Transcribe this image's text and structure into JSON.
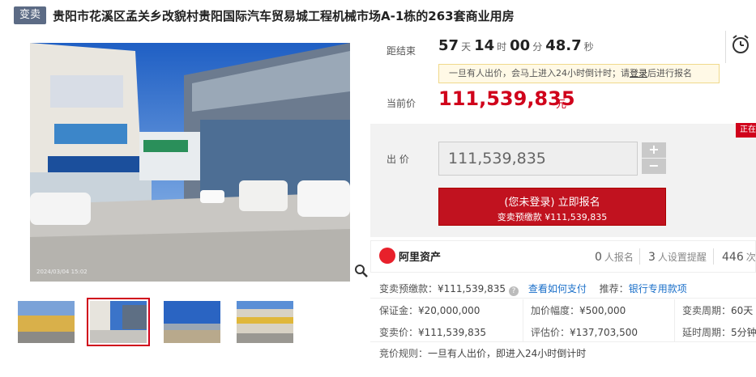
{
  "header": {
    "tag": "变卖",
    "title": "贵阳市花溪区孟关乡改貌村贵阳国际汽车贸易城工程机械市场A-1栋的263套商业用房"
  },
  "gallery": {
    "photo_timestamp": "2024/03/04 15:02",
    "thumbnails": [
      {
        "name": "thumbnail-1",
        "selected": false
      },
      {
        "name": "thumbnail-2",
        "selected": true
      },
      {
        "name": "thumbnail-3",
        "selected": false
      },
      {
        "name": "thumbnail-4",
        "selected": false
      }
    ]
  },
  "countdown": {
    "label": "距结束",
    "days": "57",
    "days_unit": "天",
    "hours": "14",
    "hours_unit": "时",
    "minutes": "00",
    "minutes_unit": "分",
    "seconds": "48.7",
    "seconds_unit": "秒"
  },
  "notice": {
    "before": "一旦有人出价，会马上进入24小时倒计时；请",
    "login": "登录",
    "after": "后进行报名"
  },
  "current_price": {
    "label": "当前价",
    "value": "111,539,835",
    "unit": "元"
  },
  "bid": {
    "label": "出 价",
    "value": "111,539,835",
    "plus": "+",
    "minus": "−",
    "ribbon": "正在进行",
    "button_line1": "(您未登录) 立即报名",
    "button_line2": "变卖预缴款 ¥111,539,835"
  },
  "platform": {
    "name": "阿里资产",
    "enrolled_count": "0",
    "enrolled_label": "人报名",
    "reminder_count": "3",
    "reminder_label": "人设置提醒",
    "views_count": "446",
    "views_label": "次"
  },
  "info": {
    "deposit_label": "变卖预缴款：",
    "deposit_value": "¥111,539,835",
    "pay_link": "查看如何支付",
    "recommend_label": "推荐：",
    "recommend_link": "银行专用款项",
    "rows": [
      {
        "k1": "保证金：",
        "v1": "¥20,000,000",
        "k2": "加价幅度：",
        "v2": "¥500,000",
        "k3": "变卖周期：",
        "v3": "60天"
      },
      {
        "k1": "变卖价：",
        "v1": "¥111,539,835",
        "k2": "评估价：",
        "v2": "¥137,703,500",
        "k3": "延时周期：",
        "v3": "5分钟"
      }
    ],
    "rule_label": "竞价规则：",
    "rule_value": "一旦有人出价，即进入24小时倒计时"
  },
  "colors": {
    "accent": "#d0021b",
    "tag": "#5c6b85",
    "link": "#1a6fc9"
  }
}
